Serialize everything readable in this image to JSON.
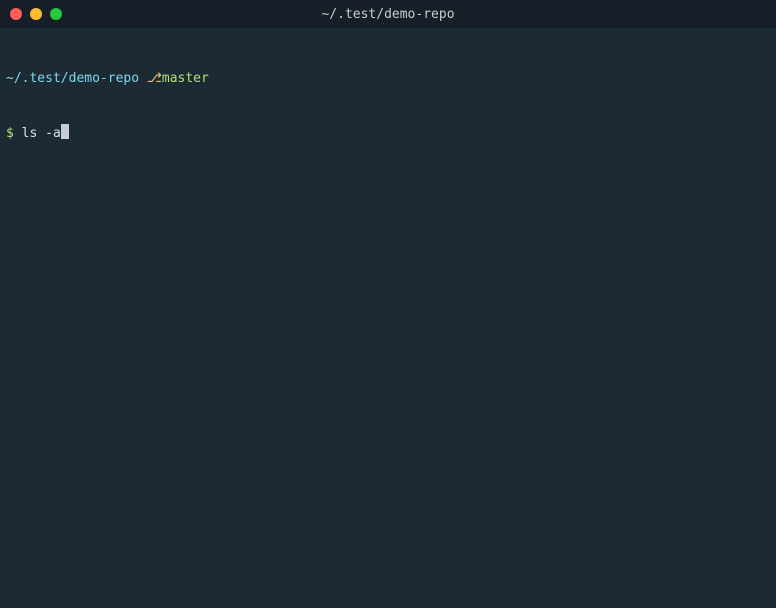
{
  "window": {
    "title": "~/.test/demo-repo"
  },
  "colors": {
    "close": "#ff5f56",
    "minimize": "#ffbd2e",
    "maximize": "#27c93f",
    "bg": "#1c2a33"
  },
  "prompt": {
    "cwd": "~/.test/demo-repo",
    "separator": " ",
    "branch_symbol": "⎇",
    "branch": "master",
    "symbol": "$",
    "command": "ls -a"
  }
}
